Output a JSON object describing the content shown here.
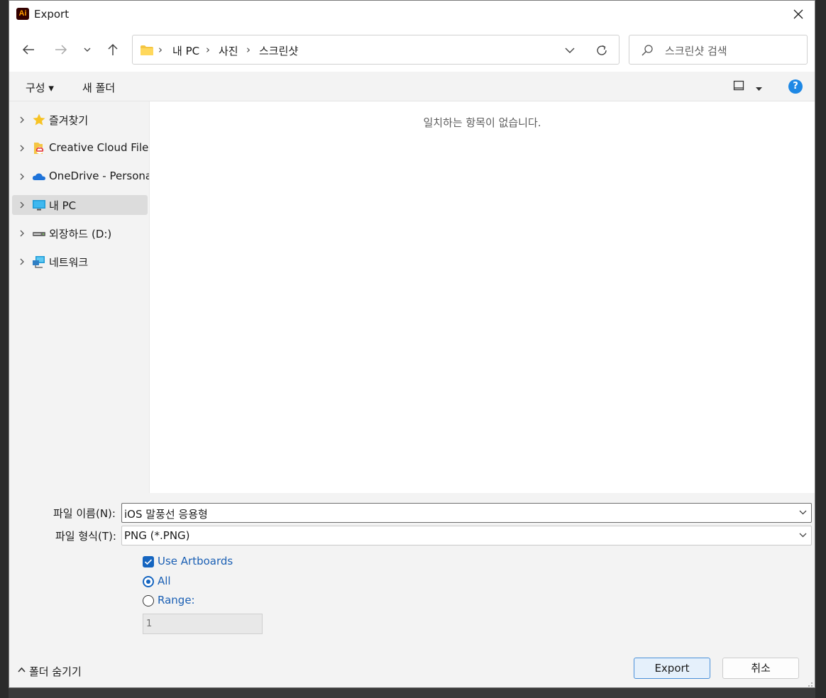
{
  "window": {
    "app_icon_text": "Ai",
    "title": "Export"
  },
  "address": {
    "crumbs": [
      "내 PC",
      "사진",
      "스크린샷"
    ]
  },
  "search": {
    "placeholder": "스크린샷 검색"
  },
  "commands": {
    "organize": "구성 ▾",
    "new_folder": "새 폴더",
    "help": "?"
  },
  "sidebar": {
    "items": [
      {
        "label": "즐겨찾기",
        "icon": "star-icon"
      },
      {
        "label": "Creative Cloud Files",
        "icon": "creative-cloud-folder-icon"
      },
      {
        "label": "OneDrive - Personal",
        "icon": "onedrive-cloud-icon"
      },
      {
        "label": "내 PC",
        "icon": "monitor-icon",
        "selected": true
      },
      {
        "label": "외장하드 (D:)",
        "icon": "drive-icon"
      },
      {
        "label": "네트워크",
        "icon": "network-icon"
      }
    ]
  },
  "content": {
    "empty_message": "일치하는 항목이 없습니다."
  },
  "form": {
    "filename_label": "파일 이름(N):",
    "filename_value": "iOS 말풍선 응용형",
    "filetype_label": "파일 형식(T):",
    "filetype_value": "PNG (*.PNG)",
    "use_artboards_label": "Use Artboards",
    "use_artboards_checked": true,
    "all_label": "All",
    "range_label": "Range:",
    "range_value": "1"
  },
  "footer": {
    "hide_folders_label": "폴더 숨기기",
    "export_button": "Export",
    "cancel_button": "취소"
  },
  "colors": {
    "accent": "#1565c0",
    "link_text": "#1a5fb4",
    "help_blue": "#1e88e5"
  }
}
